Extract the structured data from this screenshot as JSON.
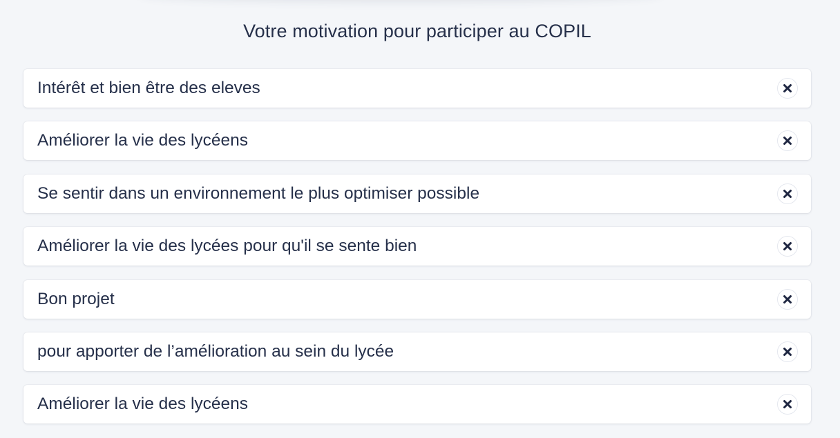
{
  "title": "Votre motivation pour participer au COPIL",
  "items": [
    {
      "text": "Intérêt et bien être des eleves",
      "action_icon": "close-icon"
    },
    {
      "text": "Améliorer la vie des lycéens",
      "action_icon": "close-icon"
    },
    {
      "text": "Se sentir dans un environnement le plus optimiser possible",
      "action_icon": "close-icon"
    },
    {
      "text": "Améliorer la vie des lycées pour qu'il se sente bien",
      "action_icon": "close-icon"
    },
    {
      "text": "Bon projet",
      "action_icon": "close-icon"
    },
    {
      "text": "pour apporter de l’amélioration au sein du lycée",
      "action_icon": "close-icon"
    },
    {
      "text": "Améliorer la vie des lycéens",
      "action_icon": "close-icon"
    }
  ],
  "colors": {
    "background": "#f4f6f9",
    "card": "#ffffff",
    "text": "#26304a",
    "icon": "#1f2742"
  }
}
